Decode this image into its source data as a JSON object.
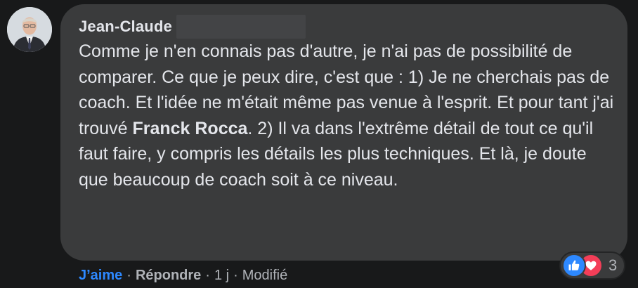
{
  "comment": {
    "author": "Jean-Claude",
    "text_before_bold": "Comme je n'en connais pas d'autre, je n'ai pas de possibilité de comparer. Ce que je peux dire, c'est que : 1) Je ne cherchais pas de coach. Et l'idée ne m'était même pas venue à l'esprit. Et pour tant j'ai trouvé ",
    "text_bold": "Franck Rocca",
    "text_after_bold": ". 2) Il va dans l'extrême détail de tout ce qu'il faut faire, y compris les détails les plus techniques. Et là, je doute que beaucoup de coach soit à ce niveau."
  },
  "reactions": {
    "icons": [
      "thumbs-up-icon",
      "heart-icon"
    ],
    "count": "3"
  },
  "actions": {
    "like_label": "J’aime",
    "reply_label": "Répondre",
    "separator": "·",
    "time": "1 j",
    "edited": "Modifié"
  },
  "colors": {
    "background": "#18191a",
    "bubble": "#3a3b3c",
    "text": "#e4e6eb",
    "secondary_text": "#b0b3b8",
    "like_blue": "#2d88ff",
    "love_red": "#f33e58"
  }
}
